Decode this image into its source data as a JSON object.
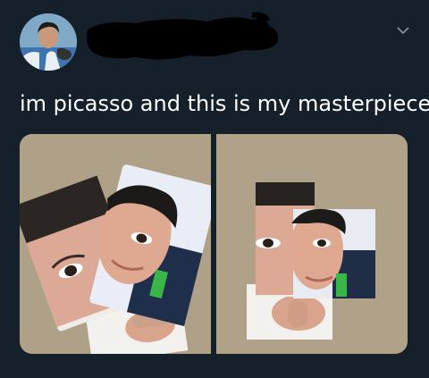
{
  "tweet": {
    "text": "im picasso and this is my masterpiece"
  },
  "icons": {
    "menu": "chevron-down-icon"
  },
  "colors": {
    "background": "#15202b",
    "text": "#ffffff",
    "muted": "#8899a6"
  }
}
